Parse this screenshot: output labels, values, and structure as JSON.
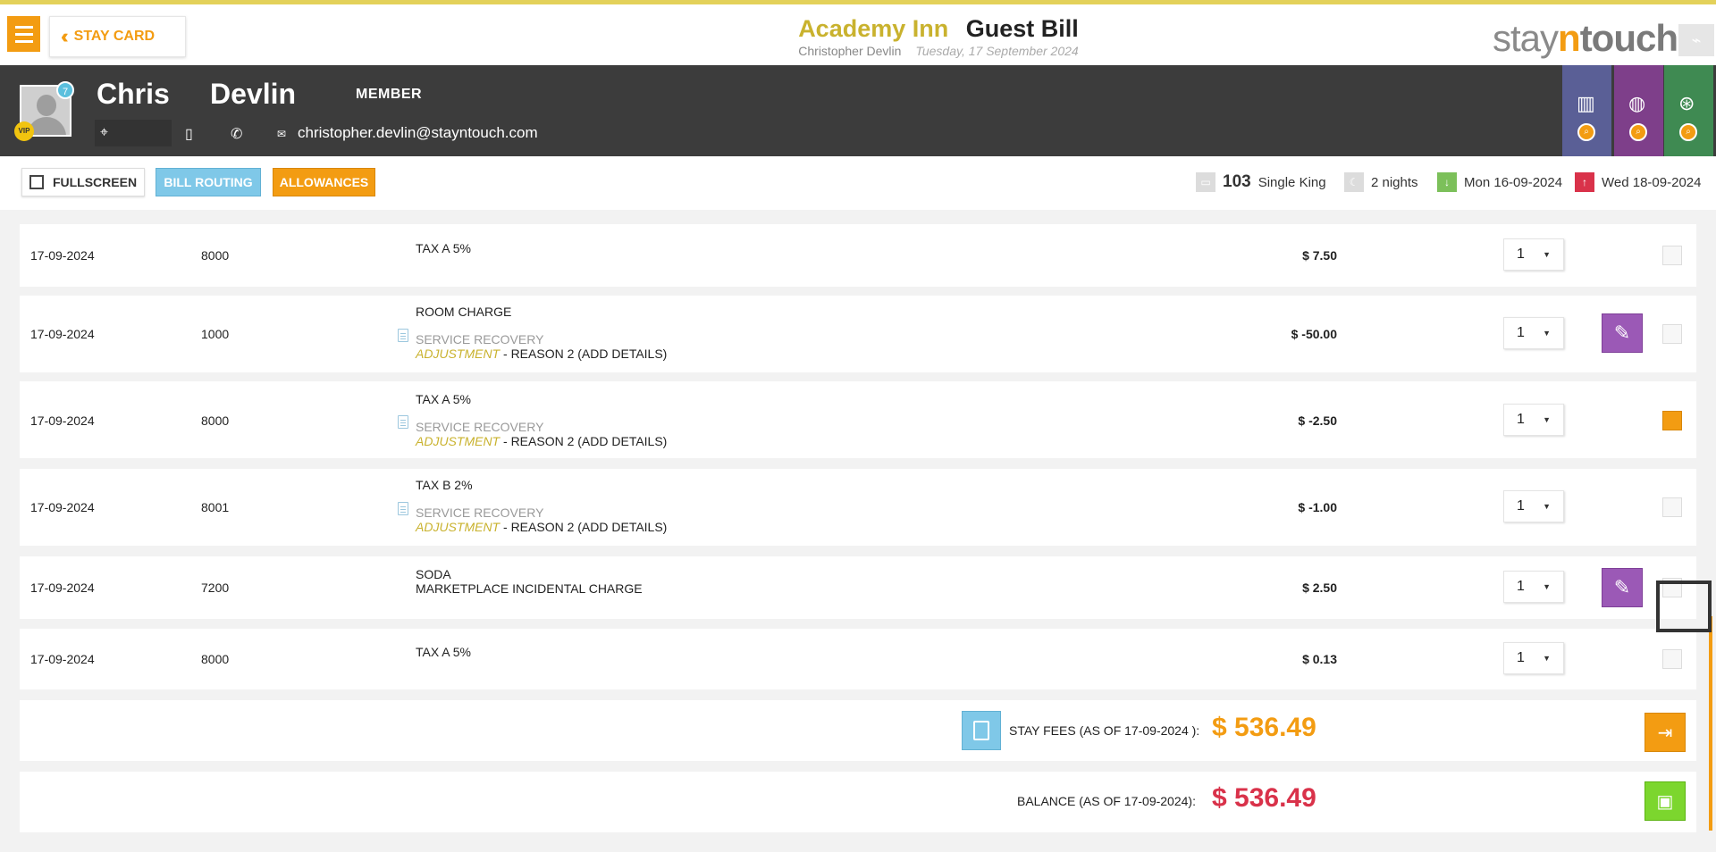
{
  "header": {
    "back_label": "STAY CARD",
    "hotel_name": "Academy Inn",
    "page_title": "Guest Bill",
    "guest_full_name": "Christopher Devlin",
    "date": "Tuesday, 17 September 2024",
    "brand_prefix": "stay",
    "brand_n": "n",
    "brand_suffix": "touch"
  },
  "guest": {
    "first_name": "Chris",
    "last_name": "Devlin",
    "membership": "MEMBER",
    "avatar_badge": "7",
    "vip": "VIP",
    "email": "christopher.devlin@stayntouch.com"
  },
  "toolbar": {
    "fullscreen_label": "FULLSCREEN",
    "routing_label": "BILL ROUTING",
    "allowances_label": "ALLOWANCES"
  },
  "stay": {
    "room_number": "103",
    "room_type": "Single King",
    "nights": "2 nights",
    "arrival": "Mon 16-09-2024",
    "departure": "Wed 18-09-2024"
  },
  "transactions": [
    {
      "date": "17-09-2024",
      "code": "8000",
      "description": "TAX A 5%",
      "amount": "$ 7.50",
      "qty": "1"
    },
    {
      "date": "17-09-2024",
      "code": "1000",
      "description": "ROOM CHARGE",
      "recovery": "SERVICE RECOVERY",
      "adjustment": "ADJUSTMENT",
      "reason": " - REASON 2 (ADD DETAILS)",
      "amount": "$ -50.00",
      "qty": "1"
    },
    {
      "date": "17-09-2024",
      "code": "8000",
      "description": "TAX A 5%",
      "recovery": "SERVICE RECOVERY",
      "adjustment": "ADJUSTMENT",
      "reason": " - REASON 2 (ADD DETAILS)",
      "amount": "$ -2.50",
      "qty": "1"
    },
    {
      "date": "17-09-2024",
      "code": "8001",
      "description": "TAX B 2%",
      "recovery": "SERVICE RECOVERY",
      "adjustment": "ADJUSTMENT",
      "reason": " - REASON 2 (ADD DETAILS)",
      "amount": "$ -1.00",
      "qty": "1"
    },
    {
      "date": "17-09-2024",
      "code": "7200",
      "description": "SODA",
      "sub": "MARKETPLACE INCIDENTAL CHARGE",
      "amount": "$ 2.50",
      "qty": "1"
    },
    {
      "date": "17-09-2024",
      "code": "8000",
      "description": "TAX A 5%",
      "amount": "$ 0.13",
      "qty": "1"
    }
  ],
  "totals": {
    "stay_fees_label": "STAY FEES (AS OF  17-09-2024 ):",
    "stay_fees_value": "$ 536.49",
    "balance_label": "BALANCE (AS OF  17-09-2024):",
    "balance_value": "$ 536.49"
  },
  "colors": {
    "accent": "#f39c12",
    "hotel_gold": "#c9b22e",
    "edit_purple": "#9b59b6",
    "balance_red": "#d9324a",
    "routing_blue": "#7fc8e8"
  }
}
